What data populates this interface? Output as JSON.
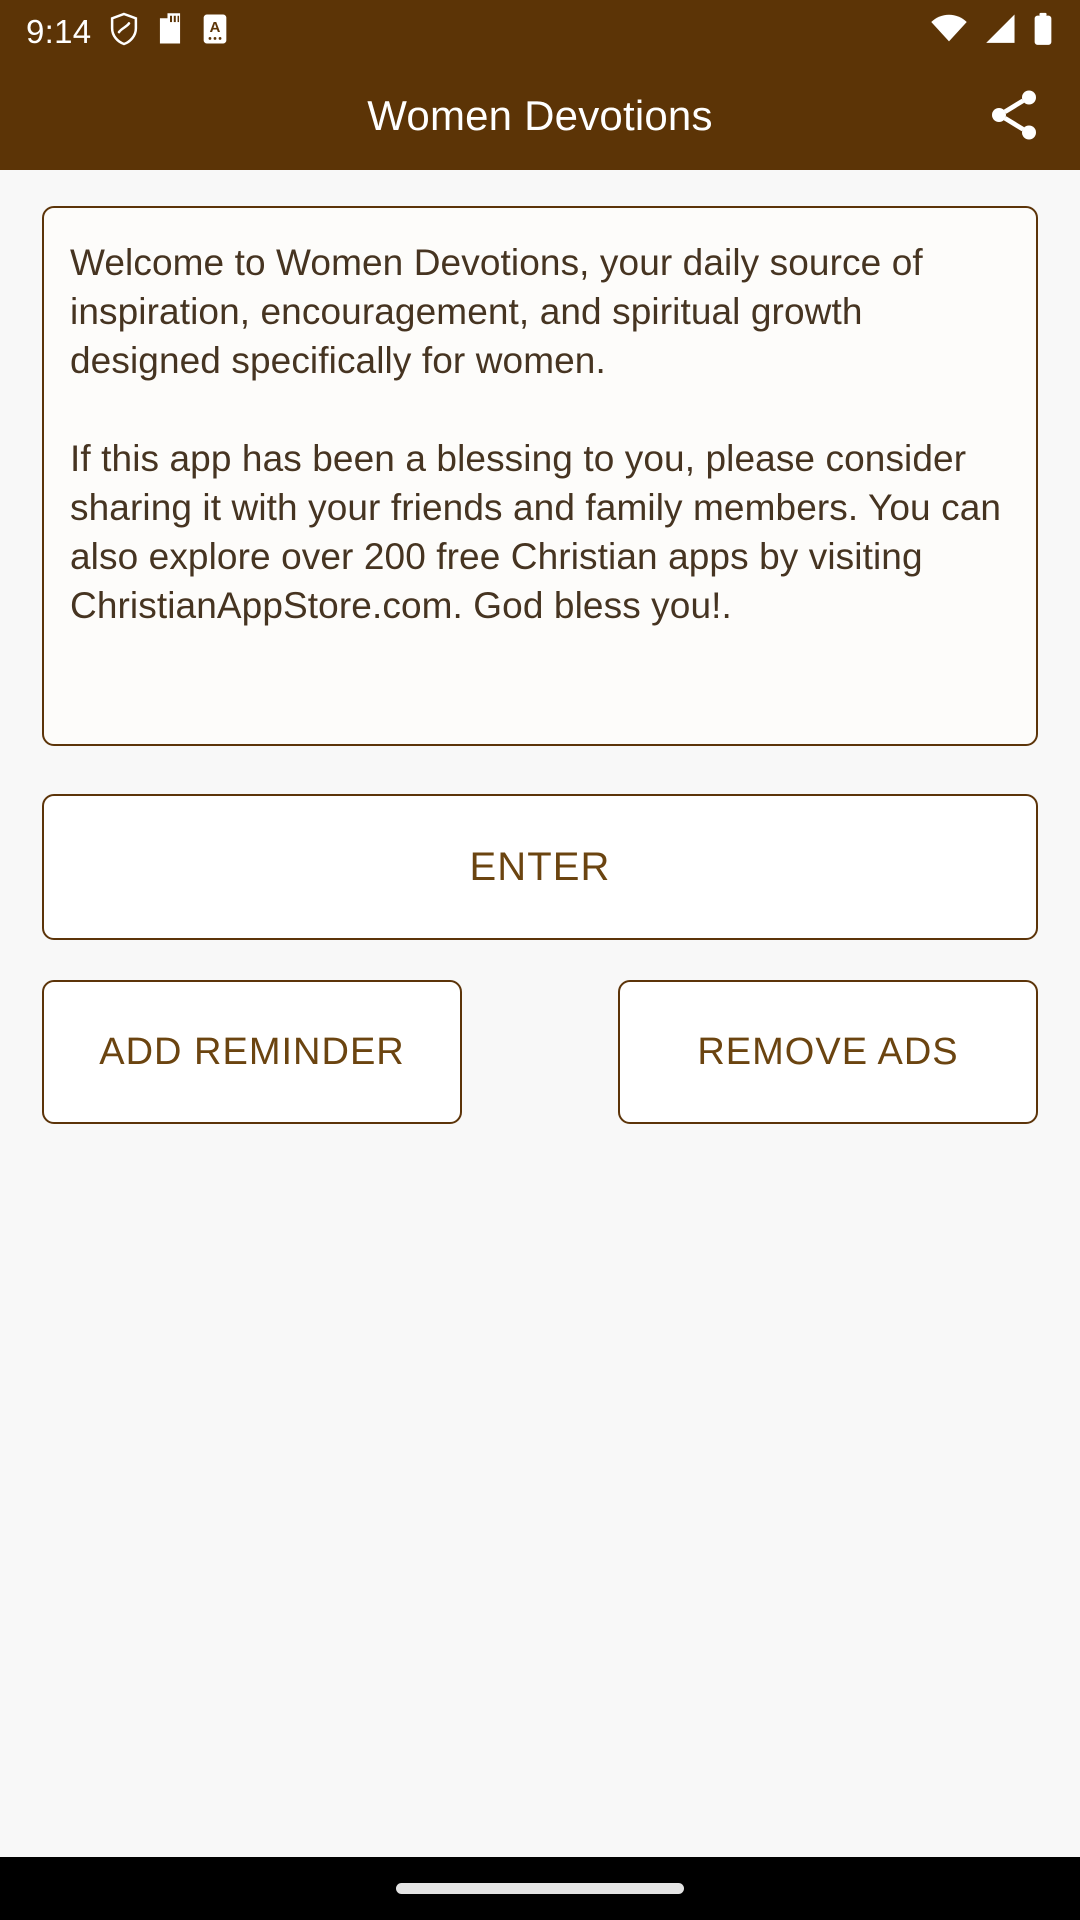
{
  "status_bar": {
    "clock": "9:14",
    "left_icons": [
      "shield-icon",
      "sd-card-icon",
      "sim-card-a-icon"
    ],
    "right_icons": [
      "wifi-icon",
      "cellular-signal-icon",
      "battery-icon"
    ]
  },
  "toolbar": {
    "title": "Women Devotions",
    "share_icon": "share-icon",
    "background_color": "#5C3406",
    "title_color": "#FFFFFF"
  },
  "welcome_card": {
    "text": "Welcome to Women Devotions, your daily source of inspiration, encouragement, and spiritual growth designed specifically for women.\n\nIf this app has been a blessing to you, please consider sharing it with your friends and family members. You can also explore over 200 free Christian apps by visiting ChristianAppStore.com. God bless you!.",
    "border_color": "#5C3409",
    "text_color": "#463421"
  },
  "buttons": {
    "enter_label": "ENTER",
    "add_reminder_label": "ADD REMINDER",
    "remove_ads_label": "REMOVE ADS",
    "border_color": "#5C3409",
    "label_color": "#6B4410"
  },
  "navigation_bar": {
    "gesture_pill": "home-gesture-pill",
    "background_color": "#000000"
  },
  "page_background_color": "#F8F8F8"
}
